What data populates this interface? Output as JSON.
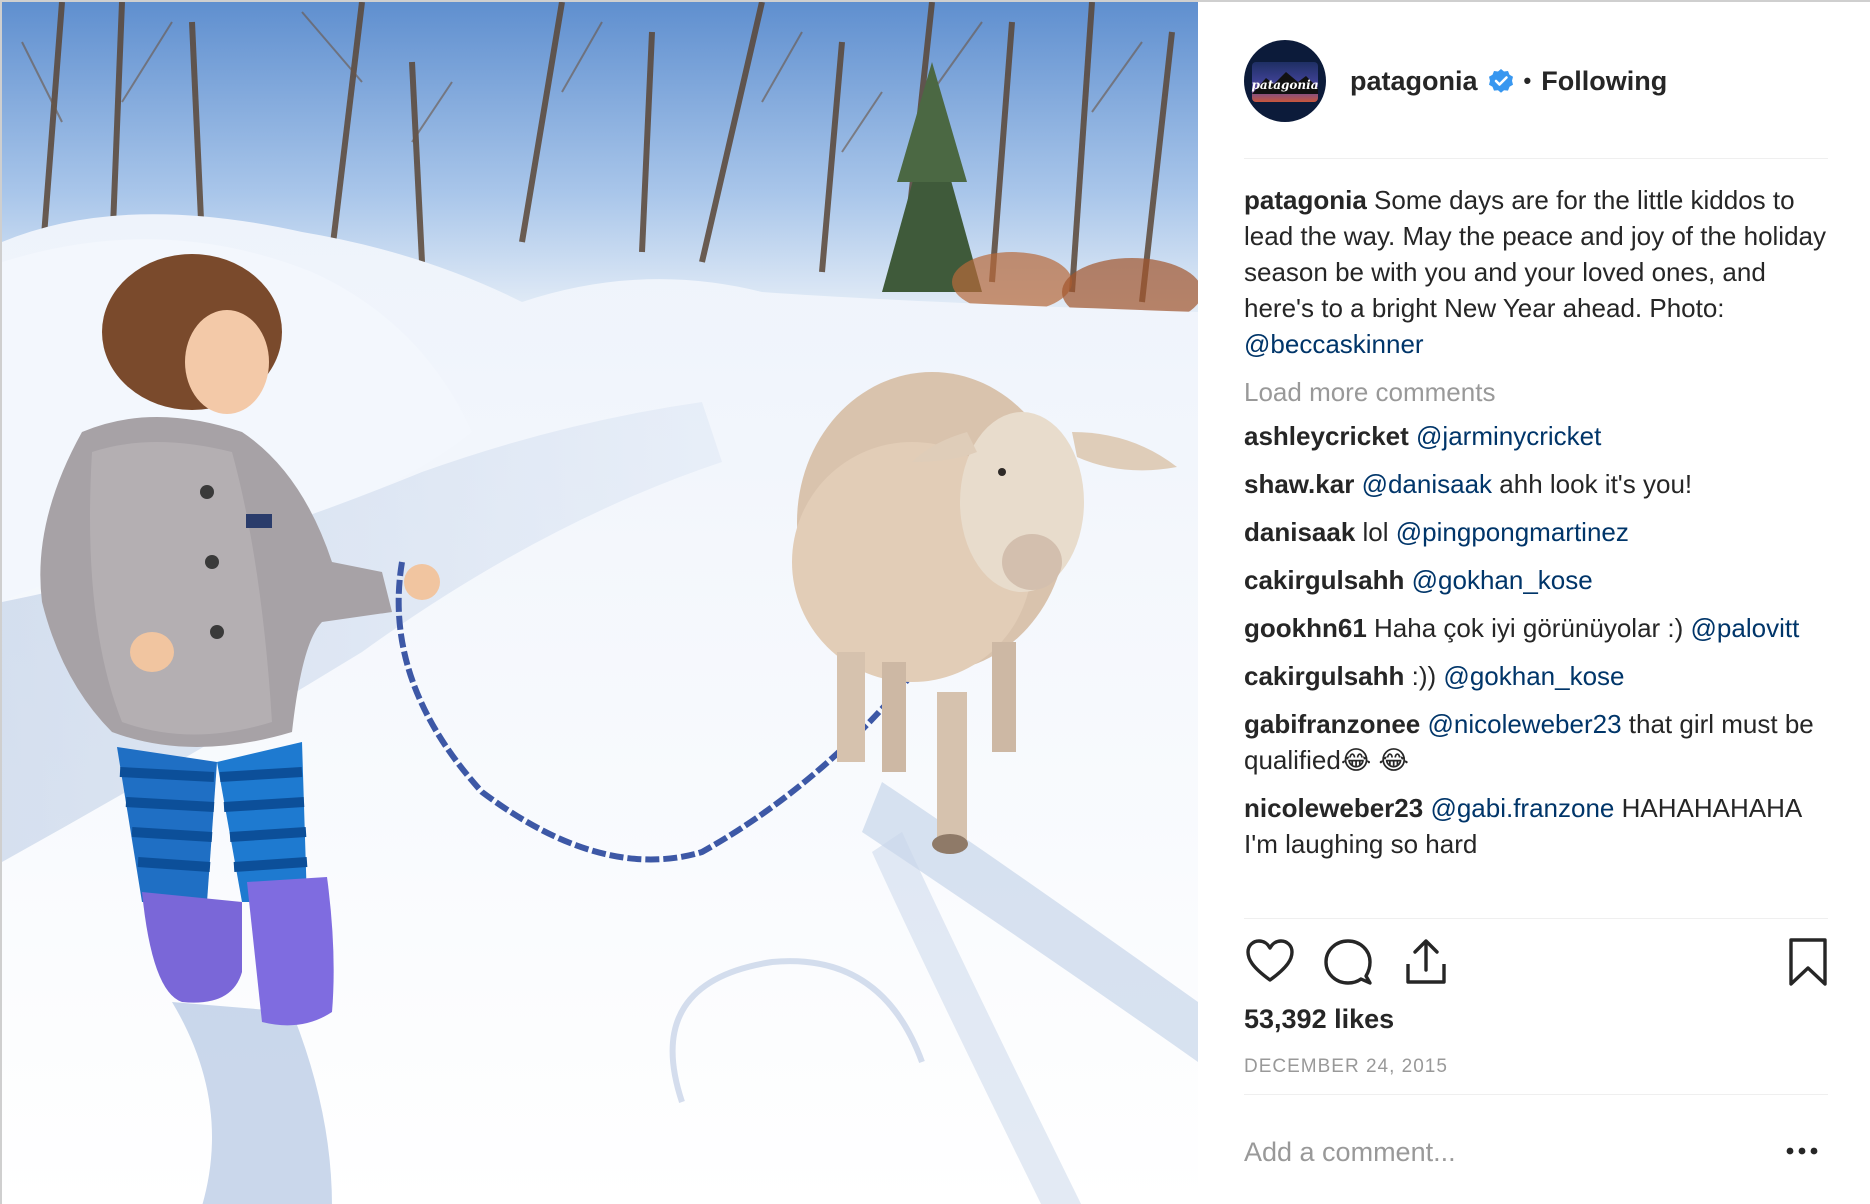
{
  "post": {
    "username": "patagonia",
    "follow_separator": "•",
    "follow_status": "Following",
    "avatar_text": "patagonia",
    "photo_alt": "Child in a fuzzy jacket leading a sheep on a leash along a snowy road"
  },
  "caption": {
    "username": "patagonia",
    "text": "Some days are for the little kiddos to lead the way. May the peace and joy of the holiday season be with you and your loved ones, and here's to a bright New Year ahead. Photo:",
    "mention": "@beccaskinner"
  },
  "load_more_label": "Load more comments",
  "comments": [
    {
      "user": "ashleycricket",
      "mention": "@jarminycricket",
      "text": ""
    },
    {
      "user": "shaw.kar",
      "mention": "@danisaak",
      "text": "ahh look it's you!"
    },
    {
      "user": "danisaak",
      "pre": "lol",
      "mention": "@pingpongmartinez",
      "text": ""
    },
    {
      "user": "cakirgulsahh",
      "mention": "@gokhan_kose",
      "text": ""
    },
    {
      "user": "gookhn61",
      "pre": "Haha çok iyi görünüyolar :)",
      "mention": "@palovitt",
      "text": ""
    },
    {
      "user": "cakirgulsahh",
      "pre": ":))",
      "mention": "@gokhan_kose",
      "text": ""
    },
    {
      "user": "gabifranzonee",
      "mention": "@nicoleweber23",
      "text": "that girl must be qualified😂 😂"
    },
    {
      "user": "nicoleweber23",
      "mention": "@gabi.franzone",
      "text": "HAHAHAHAHA I'm laughing so hard"
    }
  ],
  "actions": {
    "like_icon": "heart-icon",
    "comment_icon": "comment-bubble-icon",
    "share_icon": "share-upload-icon",
    "save_icon": "bookmark-icon"
  },
  "likes": "53,392 likes",
  "date": "DECEMBER 24, 2015",
  "add_comment_placeholder": "Add a comment...",
  "more_icon": "ellipsis-icon",
  "colors": {
    "text": "#262626",
    "mention": "#003569",
    "muted": "#999999",
    "verified": "#3897f0"
  }
}
